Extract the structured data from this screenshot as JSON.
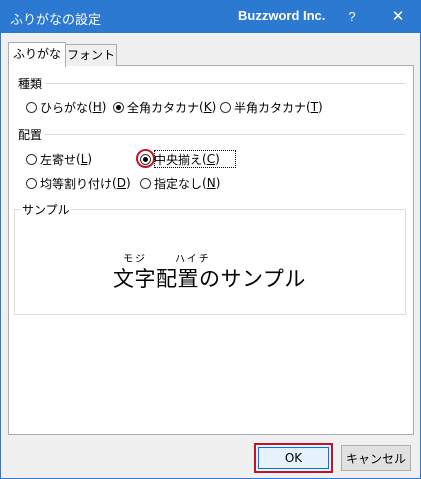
{
  "window": {
    "title": "ふりがなの設定",
    "app_name": "Buzzword Inc.",
    "help_label": "?",
    "close_label": "✕"
  },
  "tabs": [
    {
      "label": "ふりがな",
      "active": true
    },
    {
      "label": "フォント",
      "active": false
    }
  ],
  "type_group": {
    "label": "種類",
    "options": [
      {
        "text": "ひらがな",
        "key": "H",
        "checked": false
      },
      {
        "text": "全角カタカナ",
        "key": "K",
        "checked": true
      },
      {
        "text": "半角カタカナ",
        "key": "T",
        "checked": false
      }
    ]
  },
  "align_group": {
    "label": "配置",
    "options": [
      {
        "text": "左寄せ",
        "key": "L",
        "checked": false
      },
      {
        "text": "中央揃え",
        "key": "C",
        "checked": true
      },
      {
        "text": "均等割り付け",
        "key": "D",
        "checked": false
      },
      {
        "text": "指定なし",
        "key": "N",
        "checked": false
      }
    ]
  },
  "sample": {
    "label": "サンプル",
    "ruby_1": "モジ",
    "ruby_2": "ハイチ",
    "text": "文字配置のサンプル"
  },
  "buttons": {
    "ok": "OK",
    "cancel": "キャンセル"
  },
  "colors": {
    "titlebar": "#2b79d0",
    "highlight": "#c0142b"
  }
}
